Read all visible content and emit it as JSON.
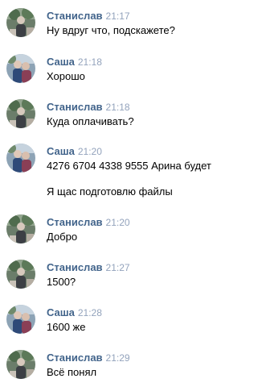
{
  "messages": [
    {
      "author": "Станислав",
      "time": "21:17",
      "lines": [
        "Ну вдруг что, подскажете?"
      ],
      "avatar": "stanislav-avatar"
    },
    {
      "author": "Саша",
      "time": "21:18",
      "lines": [
        "Хорошо"
      ],
      "avatar": "sasha-avatar"
    },
    {
      "author": "Станислав",
      "time": "21:18",
      "lines": [
        "Куда оплачивать?"
      ],
      "avatar": "stanislav-avatar"
    },
    {
      "author": "Саша",
      "time": "21:20",
      "lines": [
        "4276 6704 4338 9555 Арина будет",
        "Я щас подготовлю файлы"
      ],
      "avatar": "sasha-avatar"
    },
    {
      "author": "Станислав",
      "time": "21:20",
      "lines": [
        "Добро"
      ],
      "avatar": "stanislav-avatar"
    },
    {
      "author": "Станислав",
      "time": "21:27",
      "lines": [
        "1500?"
      ],
      "avatar": "stanislav-avatar"
    },
    {
      "author": "Саша",
      "time": "21:28",
      "lines": [
        "1600 же"
      ],
      "avatar": "sasha-avatar"
    },
    {
      "author": "Станислав",
      "time": "21:29",
      "lines": [
        "Всё понял"
      ],
      "avatar": "stanislav-avatar"
    }
  ],
  "colors": {
    "author": "#42648b",
    "time": "#93a3bc",
    "text": "#000000",
    "background": "#ffffff"
  }
}
